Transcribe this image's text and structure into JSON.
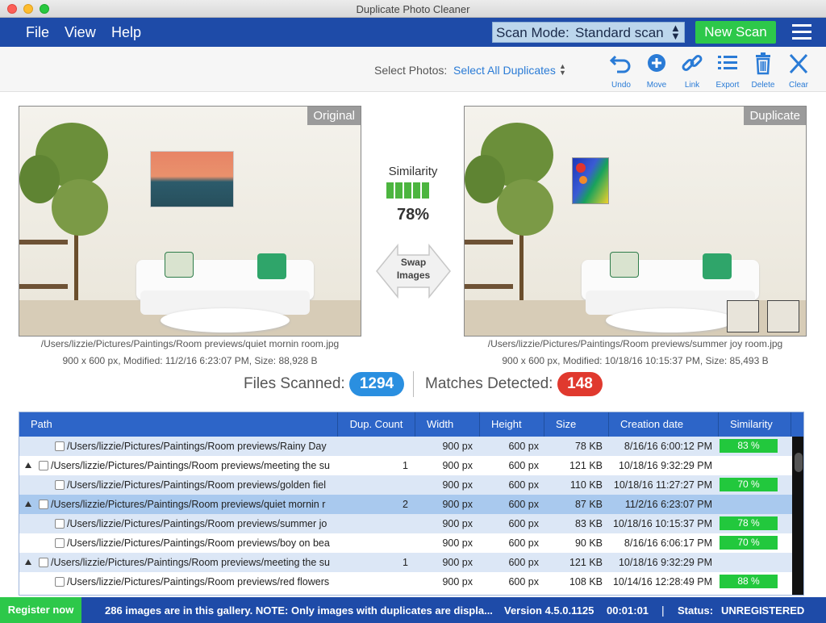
{
  "window": {
    "title": "Duplicate Photo Cleaner"
  },
  "menu": {
    "items": [
      "File",
      "View",
      "Help"
    ]
  },
  "scan_mode": {
    "label": "Scan Mode:",
    "value": "Standard scan"
  },
  "new_scan_label": "New Scan",
  "toolbar": {
    "select_label": "Select Photos:",
    "select_value": "Select All Duplicates",
    "tools": [
      {
        "label": "Undo",
        "icon": "undo-icon"
      },
      {
        "label": "Move",
        "icon": "move-icon"
      },
      {
        "label": "Link",
        "icon": "link-icon"
      },
      {
        "label": "Export",
        "icon": "export-icon"
      },
      {
        "label": "Delete",
        "icon": "delete-icon"
      },
      {
        "label": "Clear",
        "icon": "clear-icon"
      }
    ]
  },
  "original": {
    "tag": "Original",
    "path": "/Users/lizzie/Pictures/Paintings/Room previews/quiet mornin room.jpg",
    "info": "900 x 600 px, Modified: 11/2/16 6:23:07 PM, Size: 88,928 B"
  },
  "duplicate": {
    "tag": "Duplicate",
    "path": "/Users/lizzie/Pictures/Paintings/Room previews/summer joy room.jpg",
    "info": "900 x 600 px, Modified: 10/18/16 10:15:37 PM, Size: 85,493 B"
  },
  "similarity": {
    "label": "Similarity",
    "value": "78%",
    "filled_bars": 5
  },
  "swap": {
    "line1": "Swap",
    "line2": "Images"
  },
  "stats": {
    "files_scanned_label": "Files Scanned:",
    "files_scanned": "1294",
    "matches_label": "Matches Detected:",
    "matches": "148"
  },
  "table": {
    "columns": [
      "Path",
      "Dup. Count",
      "Width",
      "Height",
      "Size",
      "Creation date",
      "Similarity"
    ],
    "rows": [
      {
        "level": "child",
        "style": "alt",
        "path": "/Users/lizzie/Pictures/Paintings/Room previews/Rainy Day",
        "count": "",
        "width": "900 px",
        "height": "600 px",
        "size": "78 KB",
        "date": "8/16/16 6:00:12 PM",
        "similarity": "83 %"
      },
      {
        "level": "parent",
        "style": "",
        "path": "/Users/lizzie/Pictures/Paintings/Room previews/meeting the su",
        "count": "1",
        "width": "900 px",
        "height": "600 px",
        "size": "121 KB",
        "date": "10/18/16 9:32:29 PM",
        "similarity": ""
      },
      {
        "level": "child",
        "style": "alt",
        "path": "/Users/lizzie/Pictures/Paintings/Room previews/golden fiel",
        "count": "",
        "width": "900 px",
        "height": "600 px",
        "size": "110 KB",
        "date": "10/18/16 11:27:27 PM",
        "similarity": "70 %"
      },
      {
        "level": "parent",
        "style": "sel",
        "path": "/Users/lizzie/Pictures/Paintings/Room previews/quiet mornin r",
        "count": "2",
        "width": "900 px",
        "height": "600 px",
        "size": "87 KB",
        "date": "11/2/16 6:23:07 PM",
        "similarity": ""
      },
      {
        "level": "child",
        "style": "alt",
        "path": "/Users/lizzie/Pictures/Paintings/Room previews/summer jo",
        "count": "",
        "width": "900 px",
        "height": "600 px",
        "size": "83 KB",
        "date": "10/18/16 10:15:37 PM",
        "similarity": "78 %"
      },
      {
        "level": "child",
        "style": "",
        "path": "/Users/lizzie/Pictures/Paintings/Room previews/boy on bea",
        "count": "",
        "width": "900 px",
        "height": "600 px",
        "size": "90 KB",
        "date": "8/16/16 6:06:17 PM",
        "similarity": "70 %"
      },
      {
        "level": "parent",
        "style": "alt",
        "path": "/Users/lizzie/Pictures/Paintings/Room previews/meeting the su",
        "count": "1",
        "width": "900 px",
        "height": "600 px",
        "size": "121 KB",
        "date": "10/18/16 9:32:29 PM",
        "similarity": ""
      },
      {
        "level": "child",
        "style": "",
        "path": "/Users/lizzie/Pictures/Paintings/Room previews/red flowers",
        "count": "",
        "width": "900 px",
        "height": "600 px",
        "size": "108 KB",
        "date": "10/14/16 12:28:49 PM",
        "similarity": "88 %"
      }
    ]
  },
  "statusbar": {
    "register": "Register now",
    "note": "286 images are in this gallery. NOTE: Only images with duplicates are displa...",
    "version": "Version 4.5.0.1125",
    "time": "00:01:01",
    "separator": "|",
    "status_label": "Status:",
    "status_value": "UNREGISTERED"
  },
  "colors": {
    "brand_blue": "#1e4ba8",
    "accent_green": "#2dc84a",
    "link_blue": "#2a7bd6",
    "badge_blue": "#2a8fe0",
    "badge_red": "#e0392e"
  }
}
